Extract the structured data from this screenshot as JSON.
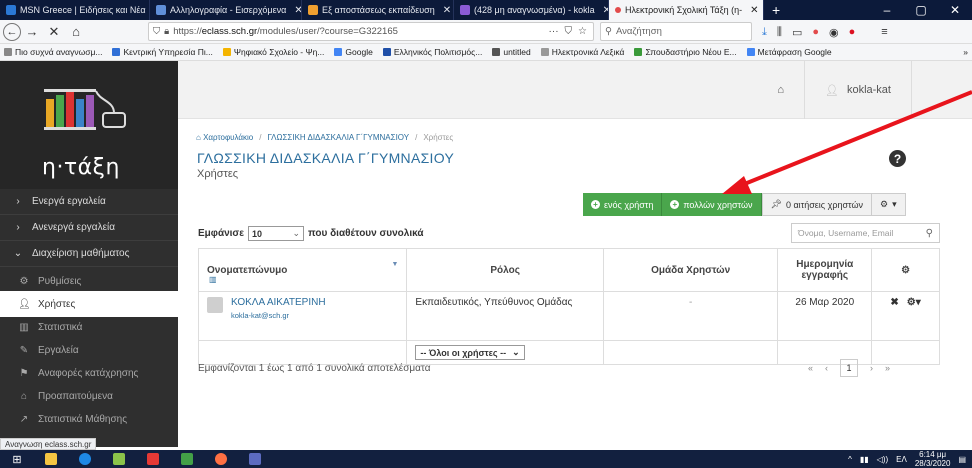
{
  "browser": {
    "tabs": [
      {
        "label": "MSN Greece | Ειδήσεις και Νέα",
        "active": false
      },
      {
        "label": "Αλληλογραφία - Εισερχόμενα",
        "active": false
      },
      {
        "label": "Εξ αποστάσεως εκπαίδευση",
        "active": false
      },
      {
        "label": "(428 μη αναγνωσμένα) - kokla",
        "active": false
      },
      {
        "label": "Ηλεκτρονική Σχολική Τάξη (η-",
        "active": true
      }
    ],
    "url_prefix": "https://",
    "url_host": "eclass.sch.gr",
    "url_path": "/modules/user/?course=G322165",
    "search_placeholder": "Αναζήτηση",
    "bookmarks": [
      "Πιο συχνά αναγνωσμ...",
      "Κεντρική Υπηρεσία Πι...",
      "Ψηφιακό Σχολείο - Ψη...",
      "Google",
      "Ελληνικός Πολιτισμός...",
      "untitled",
      "Ηλεκτρονικά Λεξικά",
      "Σπουδαστήριο Νέου Ε...",
      "Μετάφραση Google"
    ],
    "status_url": "Αναγνωση eclass.sch.gr"
  },
  "app": {
    "logo_text": "η·τάξη",
    "username": "kokla-kat"
  },
  "sidebar": {
    "items": [
      {
        "label": "Ενεργά εργαλεία",
        "kind": "top",
        "icon": "chevron-right"
      },
      {
        "label": "Ανενεργά εργαλεία",
        "kind": "top",
        "icon": "chevron-right"
      },
      {
        "label": "Διαχείριση μαθήματος",
        "kind": "top",
        "icon": "chevron-down"
      },
      {
        "label": "Ρυθμίσεις",
        "kind": "sub",
        "icon": "gears"
      },
      {
        "label": "Χρήστες",
        "kind": "sub",
        "icon": "user",
        "active": true
      },
      {
        "label": "Στατιστικά",
        "kind": "sub",
        "icon": "bar-chart"
      },
      {
        "label": "Εργαλεία",
        "kind": "sub",
        "icon": "wrench"
      },
      {
        "label": "Αναφορές κατάχρησης",
        "kind": "sub",
        "icon": "flag"
      },
      {
        "label": "Προαπαιτούμενα",
        "kind": "sub",
        "icon": "bank"
      },
      {
        "label": "Στατιστικά Μάθησης",
        "kind": "sub",
        "icon": "line-chart"
      }
    ]
  },
  "breadcrumb": {
    "home": "Χαρτοφυλάκιο",
    "course": "ΓΛΩΣΣΙΚΗ ΔΙΔΑΣΚΑΛΙΑ Γ΄ΓΥΜΝΑΣΙΟΥ",
    "current": "Χρήστες"
  },
  "main": {
    "course_title": "ΓΛΩΣΣΙΚΗ ΔΙΔΑΣΚΑΛΙΑ Γ΄ΓΥΜΝΑΣΙΟΥ",
    "subtitle": "Χρήστες",
    "actions": {
      "add_one": "ενός χρήστη",
      "add_many": "πολλών χρηστών",
      "requests": "0 αιτήσεις χρηστών"
    },
    "show_prefix": "Εμφάνισε",
    "show_value": "10",
    "show_suffix": "που διαθέτουν συνολικά",
    "search_placeholder": "Όνομα, Username, Email",
    "table": {
      "headers": {
        "name": "Ονοματεπώνυμο",
        "role": "Ρόλος",
        "group": "Ομάδα Χρηστών",
        "date": "Ημερομηνία εγγραφής"
      },
      "rows": [
        {
          "name": "ΚΟΚΛΑ ΑΙΚΑΤΕΡΙΝΗ",
          "email": "kokla-kat@sch.gr",
          "role": "Εκπαιδευτικός, Υπεύθυνος Ομάδας",
          "group": "-",
          "date": "26 Μαρ 2020"
        }
      ],
      "role_filter": "-- Όλοι οι χρήστες --"
    },
    "info": "Εμφανίζονται 1 έως 1 από 1 συνολικά αποτελέσματα",
    "pager": {
      "first": "«",
      "prev": "‹",
      "current": "1",
      "next": "›",
      "last": "»"
    }
  },
  "taskbar": {
    "lang": "ΕΛ",
    "time": "6:14 μμ",
    "date": "28/3/2020"
  },
  "colors": {
    "accent_green": "#4aa64c",
    "link_blue": "#2c6e9d",
    "sidebar_bg": "#2f2f2f",
    "arrow_red": "#e8141c"
  }
}
